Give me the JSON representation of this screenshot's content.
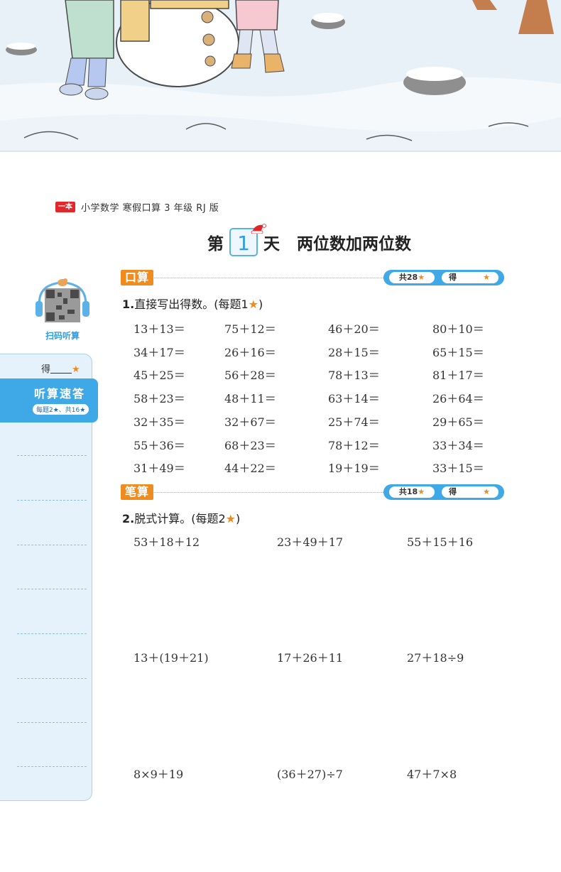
{
  "header": {
    "logo": "一本",
    "book_title": "小学数学 寒假口算 3 年级 RJ 版"
  },
  "day_title": {
    "prefix": "第",
    "number": "1",
    "suffix": "天",
    "topic": "两位数加两位数"
  },
  "qr": {
    "label": "扫码听算"
  },
  "sidebar": {
    "score_label": "得",
    "title": "听算速答",
    "subtitle": "每题2★、共16★"
  },
  "section1": {
    "tag": "口算",
    "total": "共28",
    "get": "得",
    "question_number": "1.",
    "question_text": "直接写出得数。(每题1",
    "question_close": ")",
    "columns": [
      [
        "13＋13＝",
        "34＋17＝",
        "45＋25＝",
        "58＋23＝",
        "32＋35＝",
        "55＋36＝",
        "31＋49＝"
      ],
      [
        "75＋12＝",
        "26＋16＝",
        "56＋28＝",
        "48＋11＝",
        "32＋67＝",
        "68＋23＝",
        "44＋22＝"
      ],
      [
        "46＋20＝",
        "28＋15＝",
        "78＋13＝",
        "63＋14＝",
        "25＋74＝",
        "78＋12＝",
        "19＋19＝"
      ],
      [
        "80＋10＝",
        "65＋15＝",
        "81＋17＝",
        "26＋64＝",
        "29＋65＝",
        "33＋34＝",
        "33＋15＝"
      ]
    ]
  },
  "section2": {
    "tag": "笔算",
    "total": "共18",
    "get": "得",
    "question_number": "2.",
    "question_text": "脱式计算。(每题2",
    "question_close": ")",
    "rows": [
      [
        "53＋18＋12",
        "23＋49＋17",
        "55＋15＋16"
      ],
      [
        "13＋(19＋21)",
        "17＋26＋11",
        "27＋18÷9"
      ],
      [
        "8×9＋19",
        "(36＋27)÷7",
        "47＋7×8"
      ]
    ]
  },
  "colors": {
    "accent_blue": "#3fa9e7",
    "accent_orange": "#f08c1e",
    "logo_red": "#e4262b"
  }
}
